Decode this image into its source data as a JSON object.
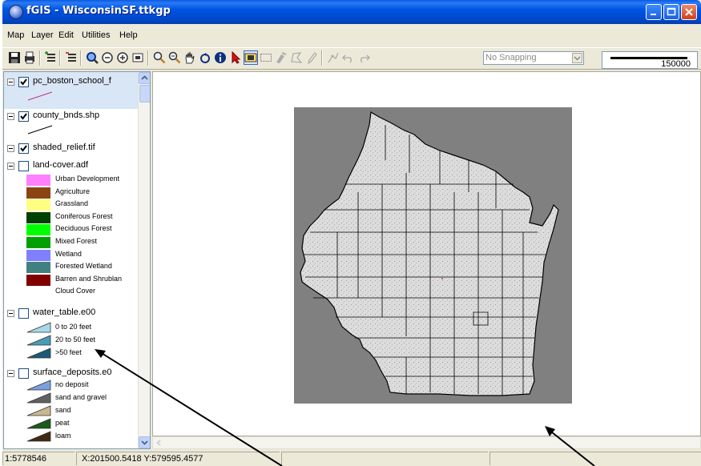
{
  "window": {
    "title": "fGIS - WisconsinSF.ttkgp"
  },
  "menu": [
    "Map",
    "Layer",
    "Edit",
    "Utilities",
    "Help"
  ],
  "toolbar": {
    "snapping": "No Snapping",
    "scale_bar_value": "150000"
  },
  "layers": [
    {
      "name": "pc_boston_school_f",
      "checked": true,
      "line_color": "#c0328c"
    },
    {
      "name": "county_bnds.shp",
      "checked": true,
      "line_color": "#000000"
    },
    {
      "name": "shaded_relief.tif",
      "checked": true
    },
    {
      "name": "land-cover.adf",
      "checked": false,
      "classes": [
        {
          "label": "Urban Development",
          "color": "#ff80ff"
        },
        {
          "label": "Agriculture",
          "color": "#8b4513"
        },
        {
          "label": "Grassland",
          "color": "#ffff80"
        },
        {
          "label": "Coniferous Forest",
          "color": "#004000"
        },
        {
          "label": "Deciduous Forest",
          "color": "#00ff00"
        },
        {
          "label": "Mixed Forest",
          "color": "#00a000"
        },
        {
          "label": "Wetland",
          "color": "#8080ff"
        },
        {
          "label": "Forested Wetland",
          "color": "#408080"
        },
        {
          "label": "Barren and Shrublan",
          "color": "#800000"
        },
        {
          "label": "Cloud Cover",
          "color": "#ffffff"
        }
      ]
    },
    {
      "name": "water_table.e00",
      "checked": false,
      "classes": [
        {
          "label": "0 to 20 feet",
          "color": "#a8d8e8"
        },
        {
          "label": "20 to 50 feet",
          "color": "#4a9ab8"
        },
        {
          "label": ">50 feet",
          "color": "#1a5a78"
        }
      ]
    },
    {
      "name": "surface_deposits.e0",
      "checked": false,
      "classes": [
        {
          "label": "no deposit",
          "color": "#7aa0e0"
        },
        {
          "label": "sand and gravel",
          "color": "#606060"
        },
        {
          "label": "sand",
          "color": "#c8b890"
        },
        {
          "label": "peat",
          "color": "#1a5a1a"
        },
        {
          "label": "loam",
          "color": "#402a10"
        }
      ]
    }
  ],
  "status": {
    "scale": "1:5778546",
    "coords": "X:201500.5418 Y:579595.4577"
  },
  "colors": {
    "titlebar": "#0054e3",
    "map_frame": "#808080",
    "state_fill": "#dcdcdc"
  },
  "icons": [
    "save-icon",
    "print-icon",
    "add-layer-icon",
    "remove-layer-icon",
    "zoom-full-icon",
    "zoom-out-icon",
    "zoom-in-icon",
    "zoom-extent-icon",
    "magnify-icon",
    "zoom-box-icon",
    "pan-icon",
    "refresh-icon",
    "info-icon",
    "select-arrow-icon",
    "select-box-icon",
    "rectangle-icon",
    "edit-icon",
    "polygon-icon",
    "pencil-icon",
    "snap-icon",
    "undo-icon",
    "redo-icon"
  ]
}
